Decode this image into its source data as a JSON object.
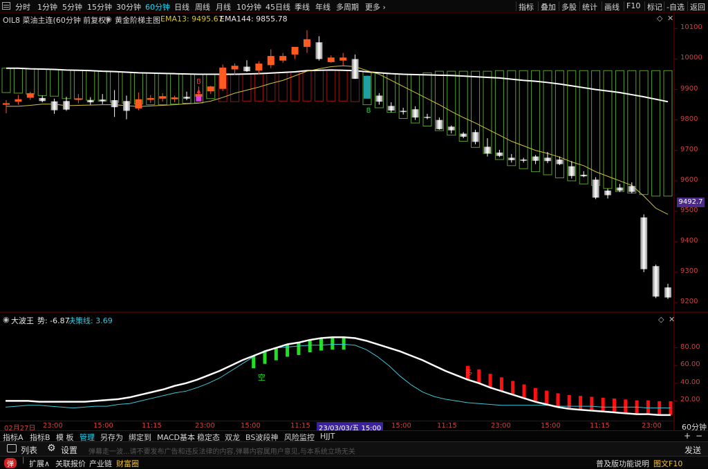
{
  "toolbar": {
    "periods": [
      "分时",
      "1分钟",
      "5分钟",
      "15分钟",
      "30分钟",
      "60分钟",
      "日线",
      "周线",
      "月线",
      "10分钟",
      "45日线",
      "季线",
      "年线",
      "多周期",
      "更多 ›"
    ],
    "active_period": "60分钟",
    "tools": [
      "指标",
      "叠加",
      "多股",
      "统计",
      "画线",
      "F10",
      "标记",
      "-自选",
      "返回"
    ]
  },
  "main_chart": {
    "symbol_label": "OIL8 菜油主连(60分钟 前复权)",
    "indicator_name": "黄金阶梯主图",
    "ema13_label": "EMA13: 9495.67",
    "ema144_label": "EMA144: 9855.78",
    "price_ticks": [
      "10100",
      "10000",
      "9900",
      "9800",
      "9700",
      "9600",
      "9500",
      "9400",
      "9300",
      "9200"
    ],
    "current_price": "9492.7",
    "signal_buy": "B",
    "signal_sell": "B",
    "colors": {
      "up": "#ff5a1f",
      "down": "#ffffff",
      "ema13": "#d6c43a",
      "ema144": "#ffffff",
      "ladder_green": "#5aa02c",
      "ladder_red": "#a01010"
    }
  },
  "chart_data": {
    "type": "candlestick",
    "ylim": [
      9180,
      10110
    ],
    "candles": [
      {
        "o": 9850,
        "h": 9865,
        "l": 9822,
        "c": 9855
      },
      {
        "o": 9860,
        "h": 9882,
        "l": 9850,
        "c": 9868
      },
      {
        "o": 9873,
        "h": 9893,
        "l": 9866,
        "c": 9888
      },
      {
        "o": 9872,
        "h": 9880,
        "l": 9858,
        "c": 9862
      },
      {
        "o": 9861,
        "h": 9870,
        "l": 9820,
        "c": 9832
      },
      {
        "o": 9862,
        "h": 9876,
        "l": 9830,
        "c": 9834
      },
      {
        "o": 9866,
        "h": 9885,
        "l": 9855,
        "c": 9871
      },
      {
        "o": 9865,
        "h": 9875,
        "l": 9850,
        "c": 9858
      },
      {
        "o": 9867,
        "h": 9885,
        "l": 9852,
        "c": 9861
      },
      {
        "o": 9865,
        "h": 9898,
        "l": 9810,
        "c": 9842
      },
      {
        "o": 9862,
        "h": 9880,
        "l": 9802,
        "c": 9830
      },
      {
        "o": 9838,
        "h": 9890,
        "l": 9832,
        "c": 9868
      },
      {
        "o": 9866,
        "h": 9882,
        "l": 9855,
        "c": 9872
      },
      {
        "o": 9870,
        "h": 9888,
        "l": 9860,
        "c": 9878
      },
      {
        "o": 9868,
        "h": 9880,
        "l": 9858,
        "c": 9874
      },
      {
        "o": 9876,
        "h": 9893,
        "l": 9865,
        "c": 9870
      },
      {
        "o": 9876,
        "h": 9910,
        "l": 9870,
        "c": 9885
      },
      {
        "o": 9894,
        "h": 9912,
        "l": 9885,
        "c": 9910
      },
      {
        "o": 9902,
        "h": 9982,
        "l": 9895,
        "c": 9972
      },
      {
        "o": 9966,
        "h": 9986,
        "l": 9948,
        "c": 9978
      },
      {
        "o": 9975,
        "h": 9996,
        "l": 9958,
        "c": 9960
      },
      {
        "o": 9962,
        "h": 9993,
        "l": 9950,
        "c": 9985
      },
      {
        "o": 9980,
        "h": 10032,
        "l": 9970,
        "c": 10010
      },
      {
        "o": 9995,
        "h": 10020,
        "l": 9988,
        "c": 10010
      },
      {
        "o": 10015,
        "h": 10038,
        "l": 10000,
        "c": 10040
      },
      {
        "o": 10040,
        "h": 10095,
        "l": 10020,
        "c": 10065
      },
      {
        "o": 10055,
        "h": 10075,
        "l": 9995,
        "c": 10000
      },
      {
        "o": 9990,
        "h": 10012,
        "l": 9988,
        "c": 10005
      },
      {
        "o": 9995,
        "h": 10020,
        "l": 9978,
        "c": 10005
      },
      {
        "o": 10000,
        "h": 10015,
        "l": 9938,
        "c": 9935
      },
      {
        "o": 9938,
        "h": 9945,
        "l": 9870,
        "c": 9885
      },
      {
        "o": 9880,
        "h": 9888,
        "l": 9850,
        "c": 9860
      },
      {
        "o": 9846,
        "h": 9858,
        "l": 9825,
        "c": 9831
      },
      {
        "o": 9830,
        "h": 9840,
        "l": 9818,
        "c": 9826
      },
      {
        "o": 9835,
        "h": 9845,
        "l": 9800,
        "c": 9808
      },
      {
        "o": 9810,
        "h": 9820,
        "l": 9802,
        "c": 9808
      },
      {
        "o": 9800,
        "h": 9808,
        "l": 9768,
        "c": 9770
      },
      {
        "o": 9778,
        "h": 9782,
        "l": 9756,
        "c": 9766
      },
      {
        "o": 9755,
        "h": 9760,
        "l": 9740,
        "c": 9745
      },
      {
        "o": 9760,
        "h": 9768,
        "l": 9720,
        "c": 9728
      },
      {
        "o": 9712,
        "h": 9740,
        "l": 9680,
        "c": 9690
      },
      {
        "o": 9693,
        "h": 9702,
        "l": 9678,
        "c": 9682
      },
      {
        "o": 9676,
        "h": 9688,
        "l": 9660,
        "c": 9668
      },
      {
        "o": 9670,
        "h": 9676,
        "l": 9660,
        "c": 9666
      },
      {
        "o": 9680,
        "h": 9685,
        "l": 9655,
        "c": 9666
      },
      {
        "o": 9676,
        "h": 9695,
        "l": 9658,
        "c": 9665
      },
      {
        "o": 9670,
        "h": 9680,
        "l": 9652,
        "c": 9655
      },
      {
        "o": 9648,
        "h": 9665,
        "l": 9608,
        "c": 9616
      },
      {
        "o": 9620,
        "h": 9632,
        "l": 9612,
        "c": 9615
      },
      {
        "o": 9604,
        "h": 9612,
        "l": 9540,
        "c": 9545
      },
      {
        "o": 9568,
        "h": 9574,
        "l": 9542,
        "c": 9553
      },
      {
        "o": 9578,
        "h": 9590,
        "l": 9563,
        "c": 9568
      },
      {
        "o": 9583,
        "h": 9595,
        "l": 9559,
        "c": 9564
      },
      {
        "o": 9480,
        "h": 9490,
        "l": 9300,
        "c": 9310
      },
      {
        "o": 9320,
        "h": 9325,
        "l": 9215,
        "c": 9220
      },
      {
        "o": 9250,
        "h": 9262,
        "l": 9212,
        "c": 9217
      }
    ],
    "ema13": [
      9845,
      9845,
      9848,
      9852,
      9852,
      9847,
      9848,
      9849,
      9850,
      9850,
      9847,
      9844,
      9846,
      9848,
      9850,
      9853,
      9855,
      9862,
      9874,
      9888,
      9898,
      9908,
      9920,
      9930,
      9945,
      9960,
      9968,
      9975,
      9978,
      9975,
      9962,
      9950,
      9930,
      9910,
      9890,
      9870,
      9850,
      9828,
      9808,
      9790,
      9770,
      9750,
      9730,
      9715,
      9700,
      9690,
      9678,
      9662,
      9650,
      9630,
      9615,
      9600,
      9585,
      9550,
      9510,
      9490
    ],
    "ema144": [
      9970,
      9970,
      9968,
      9967,
      9966,
      9964,
      9963,
      9962,
      9960,
      9959,
      9957,
      9955,
      9954,
      9953,
      9952,
      9951,
      9950,
      9950,
      9950,
      9950,
      9951,
      9952,
      9954,
      9956,
      9958,
      9962,
      9963,
      9964,
      9963,
      9962,
      9958,
      9955,
      9952,
      9950,
      9949,
      9948,
      9947,
      9946,
      9944,
      9942,
      9940,
      9938,
      9934,
      9930,
      9927,
      9923,
      9918,
      9912,
      9906,
      9900,
      9895,
      9890,
      9883,
      9876,
      9868,
      9860
    ],
    "ladder_high": [
      9970,
      9970,
      9968,
      9967,
      9966,
      9964,
      9963,
      9962,
      9960,
      9959,
      9957,
      9955,
      9954,
      9953,
      9952,
      9951,
      9950,
      9950,
      9950,
      9950,
      9951,
      9952,
      9954,
      9956,
      9958,
      9962,
      9963,
      9964,
      9963,
      9962,
      9958,
      9955,
      9952,
      9950,
      9949,
      9955,
      9960,
      9960,
      9960,
      9960,
      9960,
      9962,
      9962,
      9962,
      9962,
      9962,
      9962,
      9962,
      9962,
      9962,
      9962,
      9962,
      9962,
      9962,
      9962,
      9962
    ],
    "ladder_low": [
      9890,
      9888,
      9885,
      9880,
      9878,
      9870,
      9868,
      9865,
      9862,
      9858,
      9855,
      9852,
      9850,
      9850,
      9852,
      9855,
      9856,
      9870,
      9860,
      9860,
      9862,
      9862,
      9862,
      9862,
      9862,
      9862,
      9862,
      9862,
      9862,
      9860,
      9850,
      9840,
      9825,
      9805,
      9790,
      9780,
      9765,
      9750,
      9730,
      9710,
      9690,
      9670,
      9650,
      9640,
      9630,
      9620,
      9610,
      9600,
      9590,
      9585,
      9575,
      9565,
      9560,
      9555,
      9550,
      9550
    ],
    "ladder_red_start": 18,
    "ladder_red_end": 29
  },
  "indicator": {
    "name": "大波王",
    "trend_label": "势: -6.87",
    "decision_label": "决策线: 3.69",
    "ticks": [
      "80.00",
      "60.00",
      "40.00",
      "20.00"
    ],
    "signal_empty": "空",
    "signal_multi": "多",
    "ylim": [
      0,
      100
    ],
    "trend": [
      20,
      20,
      20,
      19,
      19,
      19,
      19,
      19,
      20,
      21,
      22,
      24,
      27,
      30,
      33,
      37,
      40,
      44,
      49,
      54,
      60,
      66,
      71,
      76,
      80,
      84,
      86,
      89,
      91,
      92,
      92,
      91,
      88,
      84,
      80,
      76,
      71,
      66,
      60,
      54,
      49,
      44,
      40,
      35,
      31,
      27,
      23,
      19,
      16,
      13,
      11,
      10,
      9,
      8,
      7,
      6,
      5,
      5,
      4,
      4
    ],
    "decision": [
      13,
      14,
      15,
      15,
      14,
      13,
      12,
      13,
      14,
      14,
      16,
      17,
      20,
      23,
      26,
      29,
      31,
      35,
      40,
      46,
      54,
      62,
      70,
      77,
      80,
      81,
      82,
      83,
      83,
      84,
      84,
      83,
      78,
      70,
      60,
      48,
      38,
      30,
      25,
      22,
      20,
      18,
      17,
      16,
      15,
      15,
      15,
      15,
      15,
      14,
      14,
      14,
      14,
      13,
      13,
      13,
      13,
      12,
      12,
      12
    ],
    "green_bars_start": 22,
    "green_bars_end": 30,
    "red_bars_start": 41,
    "red_bars_end": 59
  },
  "xaxis": {
    "labels": [
      "02月27日",
      "23:00",
      "15:00",
      "11:15",
      "23:00",
      "15:00",
      "11:15",
      "23/03/03/五 15:00",
      "15:00",
      "11:15",
      "23:00",
      "15:00",
      "11:15",
      "23:00"
    ],
    "period_label": "60分钟"
  },
  "tabs": [
    "指标A",
    "指标B",
    "模 板",
    "管理",
    "另存为",
    "绑定到",
    "MACD基本",
    "稳定态",
    "双龙",
    "BS波段神",
    "风险监控",
    "HJJT"
  ],
  "active_tab": "管理",
  "cmdbar": {
    "list_label": "列表",
    "settings_label": "设置",
    "send_label": "发送"
  },
  "statusbar": {
    "badge": "弹",
    "items": [
      "扩展∧",
      "关联报价",
      "产业链",
      "财富圈"
    ],
    "notice": "弹幕走一波...请不要发布广告和违反法律的内容,弹幕内容属用户意见,与本系统立场无关",
    "right_label": "普及版功能说明",
    "right_label2": "图文F10"
  }
}
